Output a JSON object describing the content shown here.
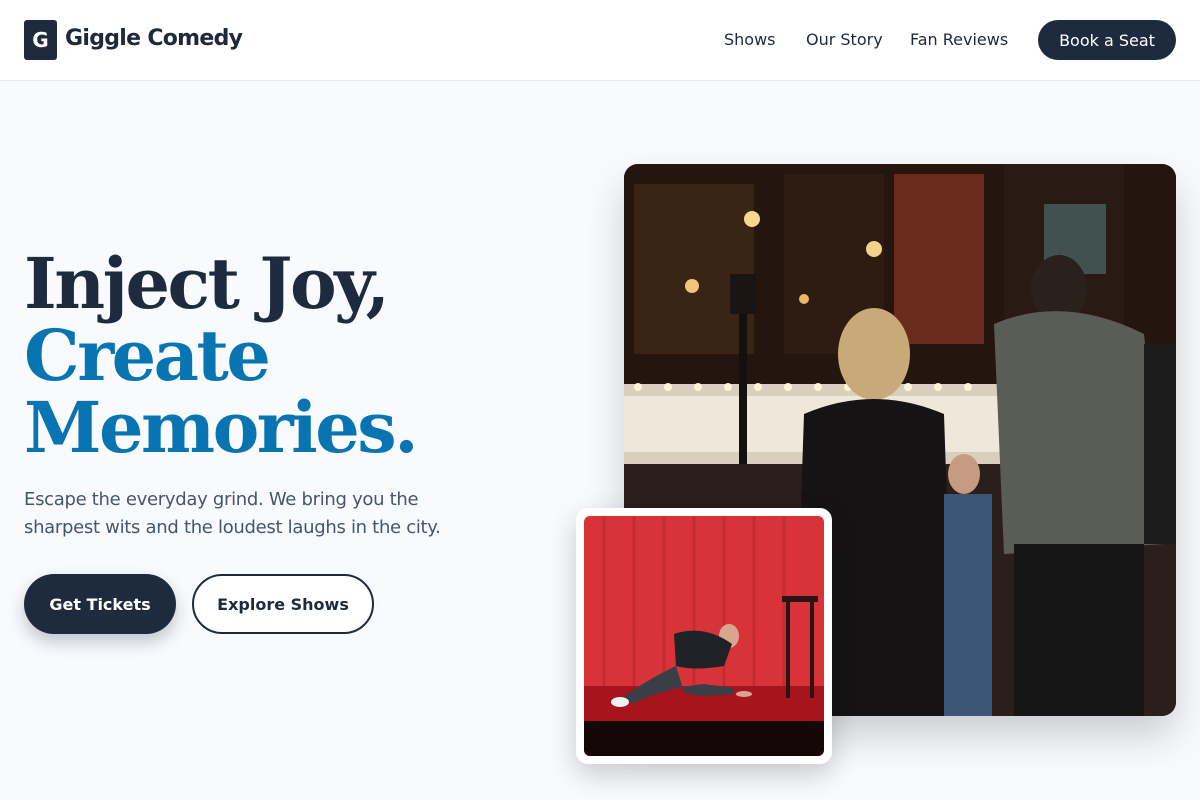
{
  "header": {
    "logo_letter": "G",
    "brand": "Giggle Comedy",
    "nav": [
      "Shows",
      "Our Story",
      "Fan Reviews"
    ],
    "cta": "Book a Seat"
  },
  "hero": {
    "headline": [
      "Inject Joy,",
      "Create",
      "Memories."
    ],
    "subtext": "Escape the everyday grind. We bring you the sharpest wits and the loudest laughs in the city.",
    "primary_button": "Get Tickets",
    "secondary_button": "Explore Shows"
  },
  "colors": {
    "dark": "#1e2a3e",
    "accent": "#0875b2",
    "background": "#f8fafd"
  },
  "images": {
    "main": "comedy-club-entrance-photo",
    "inset": "comedian-on-stage-photo"
  }
}
